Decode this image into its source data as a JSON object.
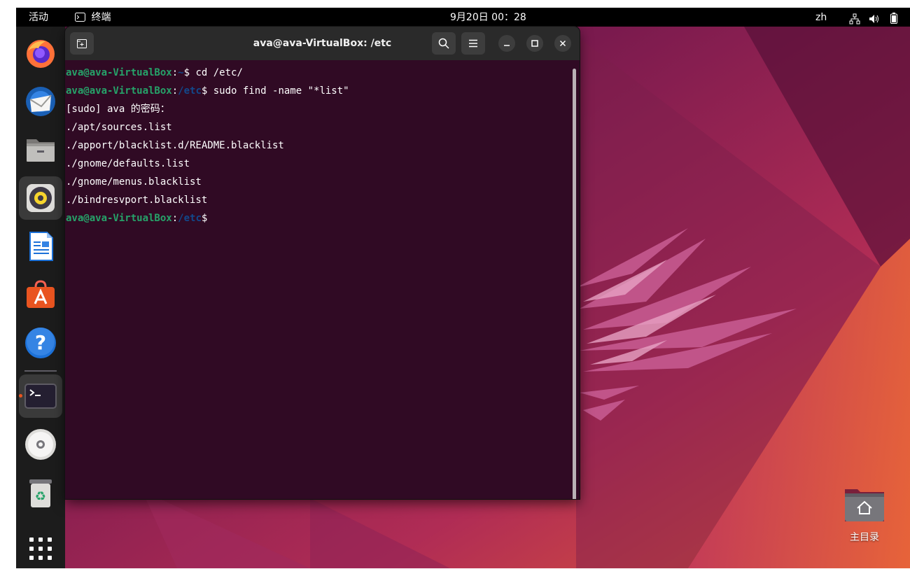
{
  "topbar": {
    "activities": "活动",
    "app_name": "终端",
    "datetime": "9月20日  00：28",
    "language": "zh"
  },
  "dock": {
    "apps": [
      {
        "name": "firefox",
        "icon": "firefox-icon"
      },
      {
        "name": "thunderbird",
        "icon": "thunderbird-icon"
      },
      {
        "name": "files",
        "icon": "files-icon"
      },
      {
        "name": "rhythmbox",
        "icon": "rhythmbox-icon"
      },
      {
        "name": "libreoffice-writer",
        "icon": "writer-icon"
      },
      {
        "name": "app-center",
        "icon": "app-center-icon"
      },
      {
        "name": "help",
        "icon": "help-icon"
      },
      {
        "name": "terminal",
        "icon": "terminal-icon"
      },
      {
        "name": "optical-disc",
        "icon": "disc-icon"
      },
      {
        "name": "trash",
        "icon": "trash-icon"
      },
      {
        "name": "show-apps",
        "icon": "app-grid-icon"
      }
    ]
  },
  "terminal": {
    "title": "ava@ava-VirtualBox: /etc",
    "lines": [
      {
        "user": "ava@ava-VirtualBox",
        "sep": ":",
        "path": "~",
        "cmd": "$ cd /etc/"
      },
      {
        "user": "ava@ava-VirtualBox",
        "sep": ":",
        "path": "/etc",
        "cmd": "$ sudo find -name \"*list\""
      },
      {
        "text": "[sudo] ava 的密码："
      },
      {
        "text": "./apt/sources.list"
      },
      {
        "text": "./apport/blacklist.d/README.blacklist"
      },
      {
        "text": "./gnome/defaults.list"
      },
      {
        "text": "./gnome/menus.blacklist"
      },
      {
        "text": "./bindresvport.blacklist"
      },
      {
        "user": "ava@ava-VirtualBox",
        "sep": ":",
        "path": "/etc",
        "cmd": "$"
      }
    ]
  },
  "desktop": {
    "home_label": "主目录"
  },
  "colors": {
    "prompt_user": "#26a269",
    "prompt_path": "#12488b",
    "terminal_bg": "#300a24"
  }
}
